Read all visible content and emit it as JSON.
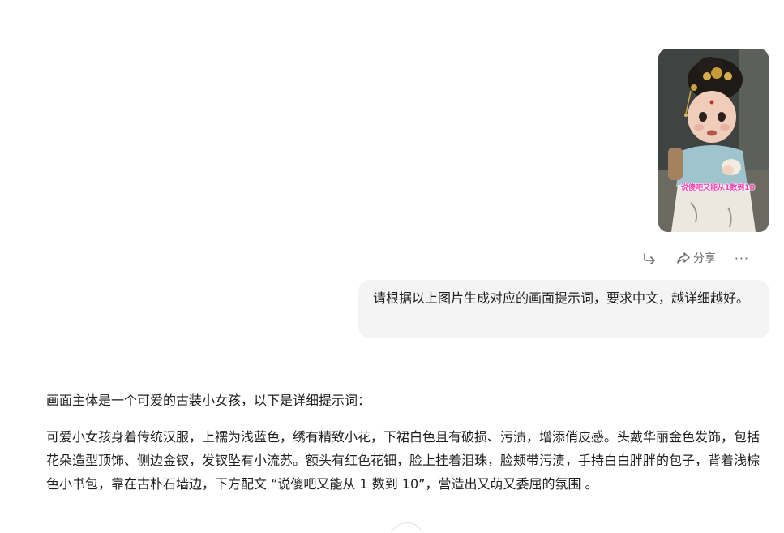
{
  "conversation": {
    "uploaded_image": {
      "caption": "说傻吧又能从1数到10",
      "icon": "image-thumbnail"
    },
    "actions": {
      "forward_icon": "forward-arrow-icon",
      "share_icon": "share-icon",
      "share_label": "分享",
      "more_icon": "more-dots-icon",
      "more_glyph": "···"
    },
    "user_message": "请根据以上图片生成对应的画面提示词，要求中文，越详细越好。",
    "assistant": {
      "intro": "画面主体是一个可爱的古装小女孩，以下是详细提示词：",
      "detail": "可爱小女孩身着传统汉服，上襦为浅蓝色，绣有精致小花，下裙白色且有破损、污渍，增添俏皮感。头戴华丽金色发饰，包括花朵造型顶饰、侧边金钗，发钗坠有小流苏。额头有红色花钿，脸上挂着泪珠，脸颊带污渍，手持白白胖胖的包子，背着浅棕色小书包，靠在古朴石墙边，下方配文 “说傻吧又能从 1 数到 10”，营造出又萌又委屈的氛围 。"
    }
  },
  "colors": {
    "bubble_bg": "#f4f4f4",
    "text": "#1f1f1f",
    "muted": "#6b6b6b",
    "caption": "#ff3fb4"
  }
}
